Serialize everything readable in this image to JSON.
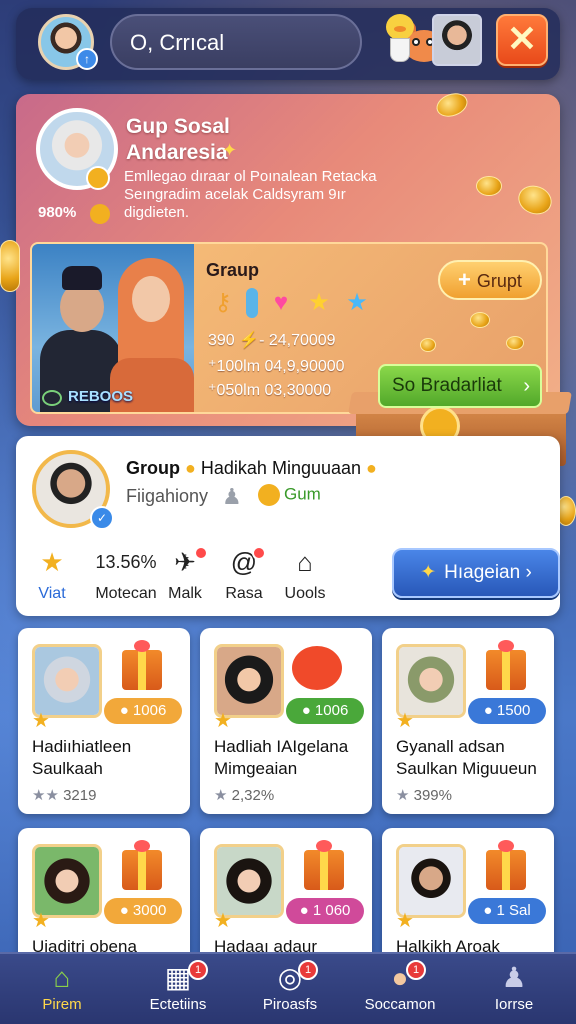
{
  "topbar": {
    "search_text": "O, Crrıcal"
  },
  "hero": {
    "title_line1": "Gup Sosal",
    "title_line2": "Andaresia",
    "description": "Emllegao dıraar ol Poınalean Retacka Seıngradim acelak Caldsyram 9ır digdieten.",
    "percent": "980%",
    "group": {
      "photo_label": "REBOOS",
      "title": "Graup",
      "button_label": "Grupt",
      "stat1": "390 ⚡- 24,70009",
      "stat2": "⁺100lm 04,9,90000",
      "stat3": "⁺050lm 03,30000"
    },
    "cta_label": "So Bradarliat"
  },
  "profile": {
    "title_bold": "Group",
    "title_rest": "Hadikah Minguuaan",
    "subtitle": "Fiigahiony",
    "gum_label": "Gum",
    "stats": [
      {
        "icon": "★",
        "label": "Viat",
        "value": ""
      },
      {
        "icon": "",
        "label": "Motecan",
        "value": "13.56%"
      },
      {
        "icon": "✈",
        "label": "Malk",
        "value": ""
      },
      {
        "icon": "@",
        "label": "Rasa",
        "value": ""
      },
      {
        "icon": "⌂",
        "label": "Uools",
        "value": ""
      }
    ],
    "hint_button": "Hıageian"
  },
  "gifts": [
    {
      "name": "Hadiıhiatleen Saulkaah",
      "pill": "1006",
      "rating": "3219",
      "pill_color": "#f2a83a"
    },
    {
      "name": "Hadliah IAIgelana Mimgeaian",
      "pill": "1006",
      "rating": "2,32%",
      "pill_color": "#4aa83a"
    },
    {
      "name": "Gyanall adsan Saulkan Miguueun",
      "pill": "1500",
      "rating": "399%",
      "pill_color": "#3a78d8"
    },
    {
      "name": "Uiaditri obena",
      "pill": "3000",
      "rating": "",
      "pill_color": "#f2a83a"
    },
    {
      "name": "Hadaaı adaur",
      "pill": "1 060",
      "rating": "",
      "pill_color": "#d04a9a"
    },
    {
      "name": "Halkikh Aroak",
      "pill": "1 Sal",
      "rating": "",
      "pill_color": "#3a78d8"
    }
  ],
  "nav": [
    {
      "label": "Pirem",
      "icon": "home-icon",
      "badge": ""
    },
    {
      "label": "Ectetiins",
      "icon": "building-icon",
      "badge": "1"
    },
    {
      "label": "Piroasfs",
      "icon": "rocket-icon",
      "badge": "1"
    },
    {
      "label": "Soccamon",
      "icon": "dog-icon",
      "badge": "1"
    },
    {
      "label": "Iorrse",
      "icon": "person-icon",
      "badge": ""
    }
  ]
}
